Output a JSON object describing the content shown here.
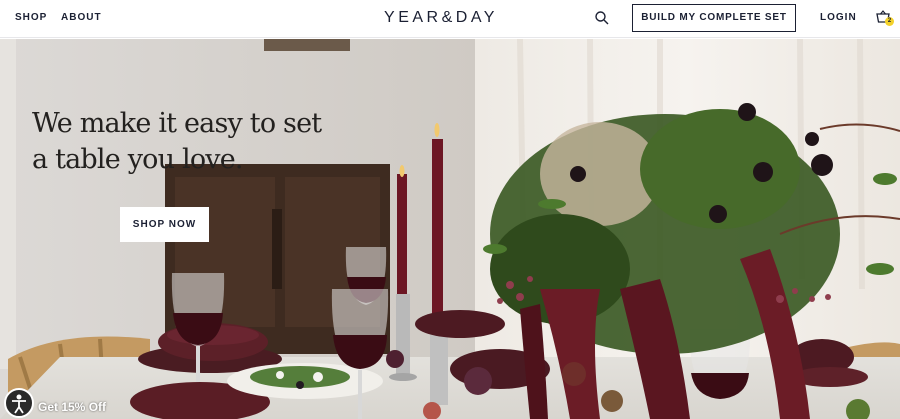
{
  "nav": {
    "shop": "SHOP",
    "about": "ABOUT",
    "logo": "YEAR&DAY",
    "build_set": "BUILD MY COMPLETE SET",
    "login": "LOGIN",
    "cart_count": "2",
    "icons": [
      "search-icon",
      "cart-icon"
    ]
  },
  "hero": {
    "headline": "We make it easy to set a table you love.",
    "cta": "SHOP NOW"
  },
  "promo": {
    "label": "Get 15% Off",
    "icon": "accessibility-icon"
  },
  "colors": {
    "navy": "#1b2033",
    "badge": "#f3d12a",
    "wine": "#5a1a22"
  }
}
